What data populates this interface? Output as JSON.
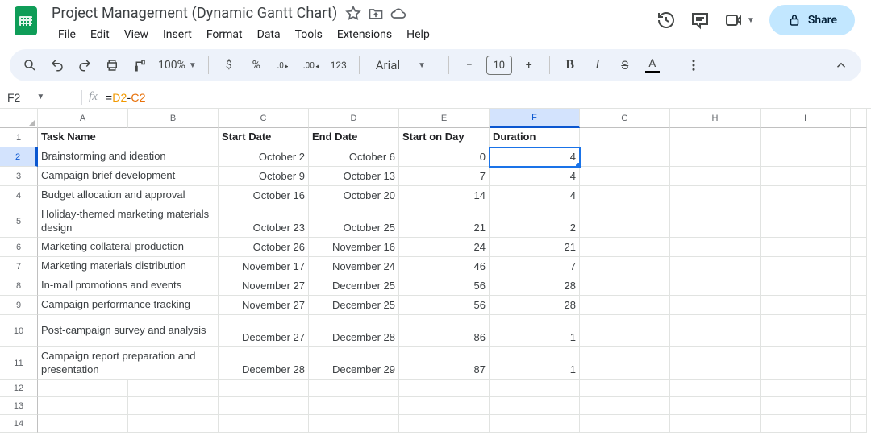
{
  "doc": {
    "title": "Project Management (Dynamic Gantt Chart)"
  },
  "menubar": [
    "File",
    "Edit",
    "View",
    "Insert",
    "Format",
    "Data",
    "Tools",
    "Extensions",
    "Help"
  ],
  "share_label": "Share",
  "toolbar": {
    "zoom": "100%",
    "currency": "$",
    "percent": "%",
    "number_format": "123",
    "font_name": "Arial",
    "font_size": "10"
  },
  "namebox": "F2",
  "formula": {
    "raw": "=D2-C2",
    "eq": "=",
    "ref1": "D2",
    "op": "-",
    "ref2": "C2"
  },
  "columns": [
    "A",
    "B",
    "C",
    "D",
    "E",
    "F",
    "G",
    "H",
    "I"
  ],
  "active_cell": "F2",
  "headers": {
    "task": "Task Name",
    "start": "Start Date",
    "end": "End Date",
    "startday": "Start on Day",
    "duration": "Duration"
  },
  "rows": [
    {
      "n": "2",
      "task": "Brainstorming and ideation",
      "start": "October 2",
      "end": "October 6",
      "startday": "0",
      "duration": "4"
    },
    {
      "n": "3",
      "task": "Campaign brief development",
      "start": "October 9",
      "end": "October 13",
      "startday": "7",
      "duration": "4"
    },
    {
      "n": "4",
      "task": "Budget allocation and approval",
      "start": "October 16",
      "end": "October 20",
      "startday": "14",
      "duration": "4"
    },
    {
      "n": "5",
      "task": "Holiday-themed marketing materials design",
      "start": "October 23",
      "end": "October 25",
      "startday": "21",
      "duration": "2"
    },
    {
      "n": "6",
      "task": "Marketing collateral production",
      "start": "October 26",
      "end": "November 16",
      "startday": "24",
      "duration": "21"
    },
    {
      "n": "7",
      "task": "Marketing materials distribution",
      "start": "November 17",
      "end": "November 24",
      "startday": "46",
      "duration": "7"
    },
    {
      "n": "8",
      "task": "In-mall promotions and events",
      "start": "November 27",
      "end": "December 25",
      "startday": "56",
      "duration": "28"
    },
    {
      "n": "9",
      "task": "Campaign performance tracking",
      "start": "November 27",
      "end": "December 25",
      "startday": "56",
      "duration": "28"
    },
    {
      "n": "10",
      "task": "Post-campaign survey and analysis",
      "start": "December 27",
      "end": "December 28",
      "startday": "86",
      "duration": "1"
    },
    {
      "n": "11",
      "task": "Campaign report preparation and presentation",
      "start": "December 28",
      "end": "December 29",
      "startday": "87",
      "duration": "1"
    }
  ],
  "empty_rows": [
    "12",
    "13",
    "14"
  ]
}
